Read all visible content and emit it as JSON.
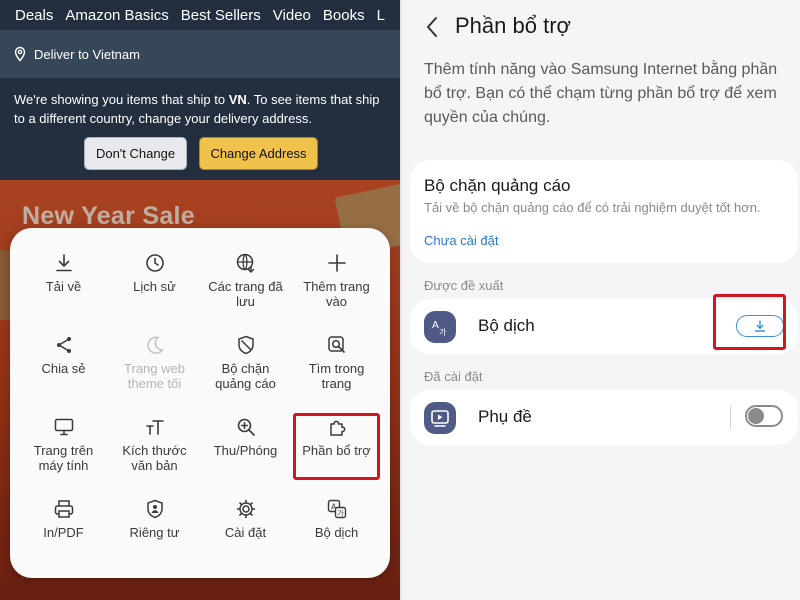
{
  "left": {
    "nav_items": [
      "Deals",
      "Amazon Basics",
      "Best Sellers",
      "Video",
      "Books",
      "L"
    ],
    "deliver_to": "Deliver to Vietnam",
    "ship_notice_prefix": "We're showing you items that ship to ",
    "ship_notice_country": "VN",
    "ship_notice_suffix": ". To see items that ship to a different country, change your delivery address.",
    "dont_change_label": "Don't Change",
    "change_address_label": "Change Address",
    "banner_title": "New Year Sale",
    "menu_items": [
      {
        "label": "Tải về",
        "icon": "download-icon",
        "enabled": true
      },
      {
        "label": "Lịch sử",
        "icon": "history-clock-icon",
        "enabled": true
      },
      {
        "label": "Các trang đã lưu",
        "icon": "saved-pages-globe-icon",
        "enabled": true
      },
      {
        "label": "Thêm trang vào",
        "icon": "add-plus-icon",
        "enabled": true
      },
      {
        "label": "Chia sẻ",
        "icon": "share-icon",
        "enabled": true
      },
      {
        "label": "Trang web theme tối",
        "icon": "moon-icon",
        "enabled": false
      },
      {
        "label": "Bộ chặn quảng cáo",
        "icon": "ad-blocker-shield-icon",
        "enabled": true
      },
      {
        "label": "Tìm trong trang",
        "icon": "find-in-page-icon",
        "enabled": true
      },
      {
        "label": "Trang trên máy tính",
        "icon": "desktop-monitor-icon",
        "enabled": true
      },
      {
        "label": "Kích thước văn bản",
        "icon": "text-size-icon",
        "enabled": true
      },
      {
        "label": "Thu/Phóng",
        "icon": "zoom-magnifier-icon",
        "enabled": true
      },
      {
        "label": "Phần bổ trợ",
        "icon": "add-ons-puzzle-icon",
        "enabled": true
      },
      {
        "label": "In/PDF",
        "icon": "printer-icon",
        "enabled": true
      },
      {
        "label": "Riêng tư",
        "icon": "privacy-shield-icon",
        "enabled": true
      },
      {
        "label": "Cài đặt",
        "icon": "settings-gear-icon",
        "enabled": true
      },
      {
        "label": "Bộ dịch",
        "icon": "translator-icon",
        "enabled": true
      }
    ]
  },
  "right": {
    "title": "Phần bổ trợ",
    "description": "Thêm tính năng vào Samsung Internet bằng phần bổ trợ. Bạn có thể chạm từng phần bổ trợ để xem quyền của chúng.",
    "ad_blocker": {
      "title": "Bộ chặn quảng cáo",
      "subtitle": "Tải về bộ chặn quảng cáo để có trải nghiệm duyệt tốt hơn.",
      "link": "Chưa cài đặt"
    },
    "recommended_label": "Được đề xuất",
    "recommended_item": "Bộ dịch",
    "installed_label": "Đã cài đặt",
    "installed_item": "Phụ đề",
    "installed_toggle_on": false
  },
  "colors": {
    "amazon_nav": "#232f3e",
    "amazon_button": "#f0c14b",
    "highlight": "#d0161e",
    "link_blue": "#2a78d0",
    "addon_icon_bg": "#4f5b86"
  }
}
